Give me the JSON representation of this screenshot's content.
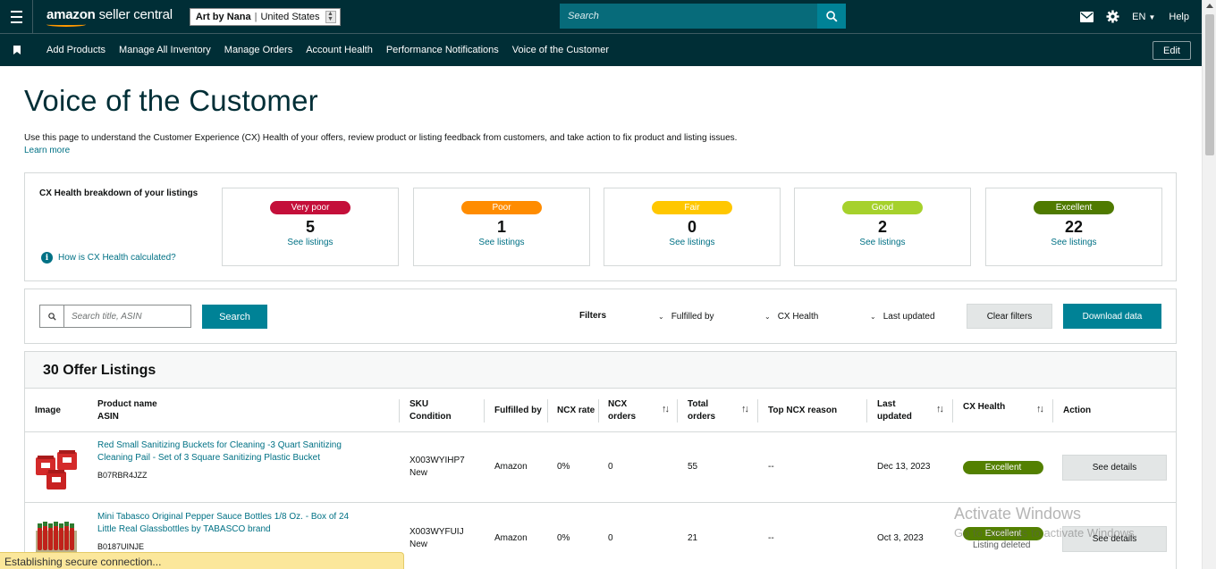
{
  "header": {
    "logo_amazon": "amazon",
    "logo_rest": " seller central",
    "store_name": "Art by Nana",
    "store_region": "United States",
    "search_placeholder": "Search",
    "lang": "EN",
    "help": "Help"
  },
  "nav": {
    "items": [
      "Add Products",
      "Manage All Inventory",
      "Manage Orders",
      "Account Health",
      "Performance Notifications",
      "Voice of the Customer"
    ],
    "edit": "Edit"
  },
  "page": {
    "title": "Voice of the Customer",
    "description": "Use this page to understand the Customer Experience (CX) Health of your offers, review product or listing feedback from customers, and take action to fix product and listing issues.",
    "learn_more": "Learn more"
  },
  "cx_health": {
    "title": "CX Health breakdown of your listings",
    "how_link": "How is CX Health calculated?",
    "cards": [
      {
        "label": "Very poor",
        "count": "5",
        "link": "See listings",
        "color": "#c40f3a"
      },
      {
        "label": "Poor",
        "count": "1",
        "link": "See listings",
        "color": "#ff8c00"
      },
      {
        "label": "Fair",
        "count": "0",
        "link": "See listings",
        "color": "#ffc700"
      },
      {
        "label": "Good",
        "count": "2",
        "link": "See listings",
        "color": "#a6d12c"
      },
      {
        "label": "Excellent",
        "count": "22",
        "link": "See listings",
        "color": "#4f7a00"
      }
    ]
  },
  "filters": {
    "search_placeholder": "Search title, ASIN",
    "search_button": "Search",
    "label": "Filters",
    "dropdowns": [
      "Fulfilled by",
      "CX Health",
      "Last updated"
    ],
    "clear": "Clear filters",
    "download": "Download data"
  },
  "listings": {
    "title": "30 Offer Listings",
    "columns": {
      "image": "Image",
      "product_name": "Product name",
      "asin": "ASIN",
      "sku": "SKU",
      "condition": "Condition",
      "fulfilled_by": "Fulfilled by",
      "ncx_rate": "NCX rate",
      "ncx_orders_1": "NCX",
      "ncx_orders_2": "orders",
      "total_orders_1": "Total",
      "total_orders_2": "orders",
      "top_ncx_reason": "Top NCX reason",
      "last_updated_1": "Last",
      "last_updated_2": "updated",
      "cx_health": "CX Health",
      "action": "Action"
    },
    "rows": [
      {
        "name": "Red Small Sanitizing Buckets for Cleaning -3 Quart Sanitizing Cleaning Pail - Set of 3 Square Sanitizing Plastic Bucket",
        "asin": "B07RBR4JZZ",
        "sku": "X003WYIHP7",
        "condition": "New",
        "fulfilled_by": "Amazon",
        "ncx_rate": "0%",
        "ncx_orders": "0",
        "total_orders": "55",
        "top_reason": "--",
        "last_updated": "Dec 13, 2023",
        "health": "Excellent",
        "action": "See details"
      },
      {
        "name": "Mini Tabasco Original Pepper Sauce Bottles 1/8 Oz. - Box of 24 Little Real Glassbottles by TABASCO brand",
        "asin": "B0187UINJE",
        "sku": "X003WYFUIJ",
        "condition": "New",
        "fulfilled_by": "Amazon",
        "ncx_rate": "0%",
        "ncx_orders": "0",
        "total_orders": "21",
        "top_reason": "--",
        "last_updated": "Oct 3, 2023",
        "health": "Excellent",
        "health_note": "Listing deleted",
        "action": "See details"
      }
    ]
  },
  "status_bar": "Establishing secure connection...",
  "watermark": {
    "line1": "Activate Windows",
    "line2": "Go to Settings to activate Windows."
  }
}
